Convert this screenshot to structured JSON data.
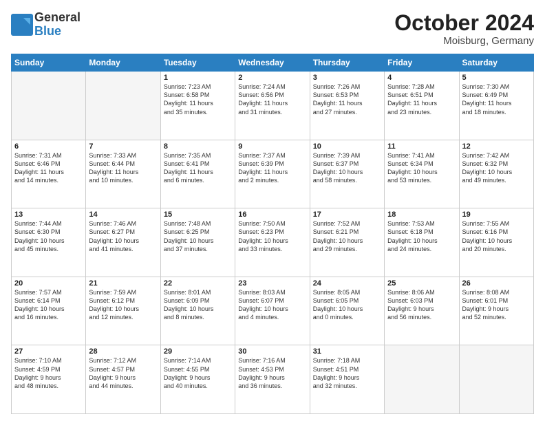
{
  "header": {
    "logo_general": "General",
    "logo_blue": "Blue",
    "month": "October 2024",
    "location": "Moisburg, Germany"
  },
  "days_of_week": [
    "Sunday",
    "Monday",
    "Tuesday",
    "Wednesday",
    "Thursday",
    "Friday",
    "Saturday"
  ],
  "weeks": [
    [
      {
        "num": "",
        "detail": ""
      },
      {
        "num": "",
        "detail": ""
      },
      {
        "num": "1",
        "detail": "Sunrise: 7:23 AM\nSunset: 6:58 PM\nDaylight: 11 hours\nand 35 minutes."
      },
      {
        "num": "2",
        "detail": "Sunrise: 7:24 AM\nSunset: 6:56 PM\nDaylight: 11 hours\nand 31 minutes."
      },
      {
        "num": "3",
        "detail": "Sunrise: 7:26 AM\nSunset: 6:53 PM\nDaylight: 11 hours\nand 27 minutes."
      },
      {
        "num": "4",
        "detail": "Sunrise: 7:28 AM\nSunset: 6:51 PM\nDaylight: 11 hours\nand 23 minutes."
      },
      {
        "num": "5",
        "detail": "Sunrise: 7:30 AM\nSunset: 6:49 PM\nDaylight: 11 hours\nand 18 minutes."
      }
    ],
    [
      {
        "num": "6",
        "detail": "Sunrise: 7:31 AM\nSunset: 6:46 PM\nDaylight: 11 hours\nand 14 minutes."
      },
      {
        "num": "7",
        "detail": "Sunrise: 7:33 AM\nSunset: 6:44 PM\nDaylight: 11 hours\nand 10 minutes."
      },
      {
        "num": "8",
        "detail": "Sunrise: 7:35 AM\nSunset: 6:41 PM\nDaylight: 11 hours\nand 6 minutes."
      },
      {
        "num": "9",
        "detail": "Sunrise: 7:37 AM\nSunset: 6:39 PM\nDaylight: 11 hours\nand 2 minutes."
      },
      {
        "num": "10",
        "detail": "Sunrise: 7:39 AM\nSunset: 6:37 PM\nDaylight: 10 hours\nand 58 minutes."
      },
      {
        "num": "11",
        "detail": "Sunrise: 7:41 AM\nSunset: 6:34 PM\nDaylight: 10 hours\nand 53 minutes."
      },
      {
        "num": "12",
        "detail": "Sunrise: 7:42 AM\nSunset: 6:32 PM\nDaylight: 10 hours\nand 49 minutes."
      }
    ],
    [
      {
        "num": "13",
        "detail": "Sunrise: 7:44 AM\nSunset: 6:30 PM\nDaylight: 10 hours\nand 45 minutes."
      },
      {
        "num": "14",
        "detail": "Sunrise: 7:46 AM\nSunset: 6:27 PM\nDaylight: 10 hours\nand 41 minutes."
      },
      {
        "num": "15",
        "detail": "Sunrise: 7:48 AM\nSunset: 6:25 PM\nDaylight: 10 hours\nand 37 minutes."
      },
      {
        "num": "16",
        "detail": "Sunrise: 7:50 AM\nSunset: 6:23 PM\nDaylight: 10 hours\nand 33 minutes."
      },
      {
        "num": "17",
        "detail": "Sunrise: 7:52 AM\nSunset: 6:21 PM\nDaylight: 10 hours\nand 29 minutes."
      },
      {
        "num": "18",
        "detail": "Sunrise: 7:53 AM\nSunset: 6:18 PM\nDaylight: 10 hours\nand 24 minutes."
      },
      {
        "num": "19",
        "detail": "Sunrise: 7:55 AM\nSunset: 6:16 PM\nDaylight: 10 hours\nand 20 minutes."
      }
    ],
    [
      {
        "num": "20",
        "detail": "Sunrise: 7:57 AM\nSunset: 6:14 PM\nDaylight: 10 hours\nand 16 minutes."
      },
      {
        "num": "21",
        "detail": "Sunrise: 7:59 AM\nSunset: 6:12 PM\nDaylight: 10 hours\nand 12 minutes."
      },
      {
        "num": "22",
        "detail": "Sunrise: 8:01 AM\nSunset: 6:09 PM\nDaylight: 10 hours\nand 8 minutes."
      },
      {
        "num": "23",
        "detail": "Sunrise: 8:03 AM\nSunset: 6:07 PM\nDaylight: 10 hours\nand 4 minutes."
      },
      {
        "num": "24",
        "detail": "Sunrise: 8:05 AM\nSunset: 6:05 PM\nDaylight: 10 hours\nand 0 minutes."
      },
      {
        "num": "25",
        "detail": "Sunrise: 8:06 AM\nSunset: 6:03 PM\nDaylight: 9 hours\nand 56 minutes."
      },
      {
        "num": "26",
        "detail": "Sunrise: 8:08 AM\nSunset: 6:01 PM\nDaylight: 9 hours\nand 52 minutes."
      }
    ],
    [
      {
        "num": "27",
        "detail": "Sunrise: 7:10 AM\nSunset: 4:59 PM\nDaylight: 9 hours\nand 48 minutes."
      },
      {
        "num": "28",
        "detail": "Sunrise: 7:12 AM\nSunset: 4:57 PM\nDaylight: 9 hours\nand 44 minutes."
      },
      {
        "num": "29",
        "detail": "Sunrise: 7:14 AM\nSunset: 4:55 PM\nDaylight: 9 hours\nand 40 minutes."
      },
      {
        "num": "30",
        "detail": "Sunrise: 7:16 AM\nSunset: 4:53 PM\nDaylight: 9 hours\nand 36 minutes."
      },
      {
        "num": "31",
        "detail": "Sunrise: 7:18 AM\nSunset: 4:51 PM\nDaylight: 9 hours\nand 32 minutes."
      },
      {
        "num": "",
        "detail": ""
      },
      {
        "num": "",
        "detail": ""
      }
    ]
  ]
}
